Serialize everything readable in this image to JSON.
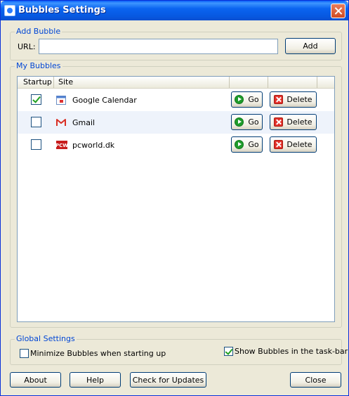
{
  "window": {
    "title": "Bubbles Settings"
  },
  "add_bubble": {
    "group_label": "Add Bubble",
    "url_label": "URL:",
    "url_value": "",
    "add_label": "Add"
  },
  "my_bubbles": {
    "group_label": "My Bubbles",
    "columns": [
      "Startup",
      "Site"
    ],
    "rows": [
      {
        "startup": true,
        "site": "Google Calendar",
        "icon": "google-calendar-icon",
        "go_label": "Go",
        "delete_label": "Delete"
      },
      {
        "startup": false,
        "site": "Gmail",
        "icon": "gmail-icon",
        "go_label": "Go",
        "delete_label": "Delete"
      },
      {
        "startup": false,
        "site": "pcworld.dk",
        "icon": "pcworld-icon",
        "go_label": "Go",
        "delete_label": "Delete"
      }
    ]
  },
  "global_settings": {
    "group_label": "Global Settings",
    "minimize_label": "Minimize Bubbles when starting up",
    "minimize_checked": false,
    "taskbar_label": "Show Bubbles in the task-bar",
    "taskbar_checked": true
  },
  "footer": {
    "about_label": "About",
    "help_label": "Help",
    "updates_label": "Check for Updates",
    "close_label": "Close"
  },
  "colors": {
    "titlebar": "#0a5ef8",
    "group_label": "#0046d5",
    "go_green": "#1e9b2b",
    "delete_red": "#e2312a"
  }
}
